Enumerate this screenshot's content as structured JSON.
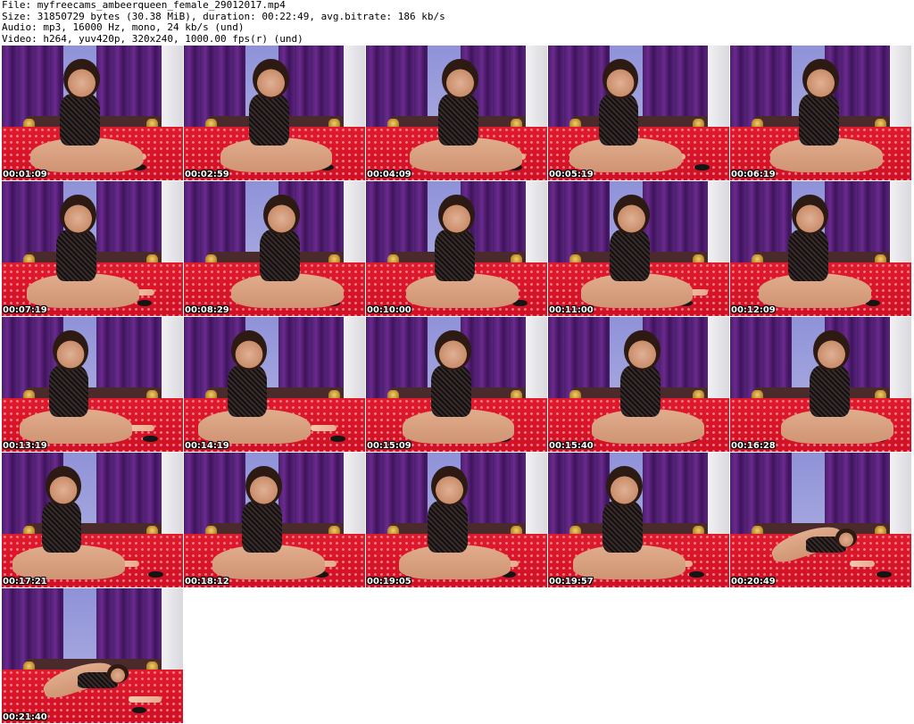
{
  "header": {
    "file_line": "File: myfreecams_ambeerqueen_female_29012017.mp4",
    "size_line": "Size: 31850729 bytes (30.38 MiB), duration: 00:22:49, avg.bitrate: 186 kb/s",
    "audio_line": "Audio: mp3, 16000 Hz, mono, 24 kb/s (und)",
    "video_line": "Video: h264, yuv420p, 320x240, 1000.00 fps(r) (und)"
  },
  "thumbnails": [
    {
      "timestamp": "00:01:09"
    },
    {
      "timestamp": "00:02:59"
    },
    {
      "timestamp": "00:04:09"
    },
    {
      "timestamp": "00:05:19"
    },
    {
      "timestamp": "00:06:19"
    },
    {
      "timestamp": "00:07:19"
    },
    {
      "timestamp": "00:08:29"
    },
    {
      "timestamp": "00:10:00"
    },
    {
      "timestamp": "00:11:00"
    },
    {
      "timestamp": "00:12:09"
    },
    {
      "timestamp": "00:13:19"
    },
    {
      "timestamp": "00:14:19"
    },
    {
      "timestamp": "00:15:09"
    },
    {
      "timestamp": "00:15:40"
    },
    {
      "timestamp": "00:16:28"
    },
    {
      "timestamp": "00:17:21"
    },
    {
      "timestamp": "00:18:12"
    },
    {
      "timestamp": "00:19:05"
    },
    {
      "timestamp": "00:19:57"
    },
    {
      "timestamp": "00:20:49"
    },
    {
      "timestamp": "00:21:40"
    }
  ],
  "colors": {
    "curtain": "#5a2380",
    "bedspread": "#e01a2c",
    "window": "#8f92d8"
  }
}
